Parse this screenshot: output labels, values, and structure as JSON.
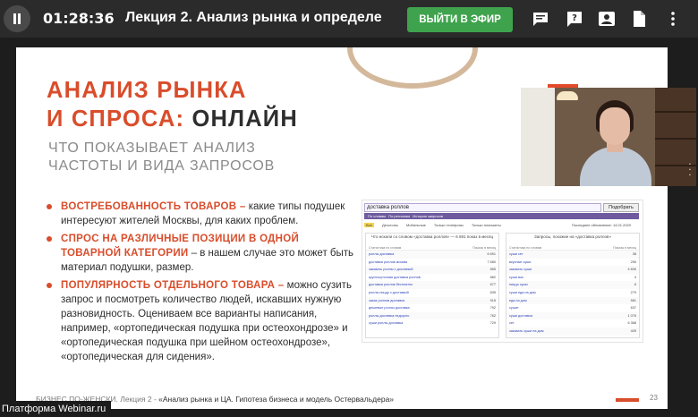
{
  "topbar": {
    "timer": "01:28:36",
    "title": "Лекция 2. Анализ рынка и определе",
    "go_live_label": "ВЫЙТИ В ЭФИР",
    "go_live_color": "#3fa34d",
    "icons": [
      "chat-icon",
      "question-icon",
      "participants-icon",
      "document-icon",
      "more-vert-icon"
    ]
  },
  "slide": {
    "heading_line1": "АНАЛИЗ РЫНКА",
    "heading_line2_accent": "И СПРОСА:",
    "heading_line2_dark": "ОНЛАЙН",
    "subtitle_line1": "ЧТО ПОКАЗЫВАЕТ АНАЛИЗ",
    "subtitle_line2": "ЧАСТОТЫ И ВИДА ЗАПРОСОВ",
    "accent_color": "#d94d2b",
    "bullets": [
      {
        "head": "Востребованность товаров –",
        "text": "какие типы подушек интересуют жителей Москвы, для каких проблем."
      },
      {
        "head": "Спрос на различные позиции в одной товарной категории",
        "text": " – в нашем случае это может быть материал подушки, размер."
      },
      {
        "head": "Популярность отдельного товара –",
        "text": "можно сузить запрос и посмотреть количество людей, искавших нужную разновидность. Оцениваем все варианты написания, например, «ортопедическая подушка при остеохондрозе» и «ортопедическая подушка при шейном остеохондрозе», «ортопедическая для сидения»."
      }
    ],
    "footer_prefix": "БИЗНЕС ПО-ЖЕНСКИ. Лекция 2 - ",
    "footer_title": "«Анализ рынка и ЦА. Гипотеза бизнеса и модель Остервальдера»",
    "page_number": "23"
  },
  "wordstat": {
    "query": "доставка роллов",
    "find_label": "Подобрать",
    "bar_labels": [
      "По словам",
      "По регионам",
      "История запросов"
    ],
    "tabs": [
      "Все",
      "Десктопы",
      "Мобильные",
      "Только телефоны",
      "Только планшеты"
    ],
    "updated": "Последнее обновление: 14.01.2020",
    "left_title": "Что искали со словом «доставка роллов» — 6 691 показ в месяц",
    "right_title": "Запросы, похожие на «доставка роллов»",
    "col_stat": "Статистика по словам",
    "col_shows": "Показы в месяц",
    "left_rows": [
      {
        "k": "роллы доставка",
        "v": "6 691"
      },
      {
        "k": "доставка роллов москва",
        "v": "7 680"
      },
      {
        "k": "заказать роллы с доставкой",
        "v": "855"
      },
      {
        "k": "круглосуточная доставка роллов",
        "v": "882"
      },
      {
        "k": "доставка роллов бесплатно",
        "v": "677"
      },
      {
        "k": "роллы пиццу с доставкой",
        "v": "835"
      },
      {
        "k": "заказ роллов доставка",
        "v": "915"
      },
      {
        "k": "дешевые роллы доставка",
        "v": "792"
      },
      {
        "k": "роллы доставка недорого",
        "v": "762"
      },
      {
        "k": "суши роллы доставка",
        "v": "729"
      }
    ],
    "right_rows": [
      {
        "k": "суши сет",
        "v": "38"
      },
      {
        "k": "вкусные суши",
        "v": "255"
      },
      {
        "k": "заказать суши",
        "v": "4 839"
      },
      {
        "k": "суши вок",
        "v": "4"
      },
      {
        "k": "пицца суши",
        "v": "6"
      },
      {
        "k": "суши еда на дом",
        "v": "279"
      },
      {
        "k": "еда на дом",
        "v": "581"
      },
      {
        "k": "сушит",
        "v": "637"
      },
      {
        "k": "суши доставка",
        "v": "1 076"
      },
      {
        "k": "сет",
        "v": "6 368"
      },
      {
        "k": "заказать суши на дом",
        "v": "409"
      }
    ]
  },
  "watermark": "Платформа Webinar.ru"
}
